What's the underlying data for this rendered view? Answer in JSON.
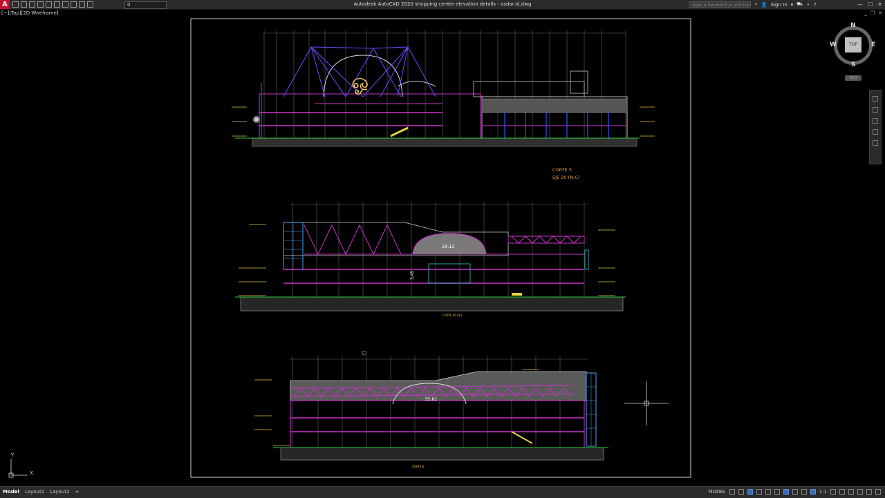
{
  "app": {
    "logo": "A",
    "title": "Autodesk AutoCAD 2020   shopping center elevation details - asdar.id.dwg"
  },
  "toolbar": {
    "layer_value": "0"
  },
  "search": {
    "placeholder": "Type a keyword or phrase"
  },
  "account": {
    "sign_in": "Sign In"
  },
  "viewport": {
    "label": "[−][Top][2D Wireframe]"
  },
  "viewcube": {
    "north": "N",
    "south": "S",
    "east": "E",
    "west": "W",
    "face": "TOP",
    "wcs": "WCS"
  },
  "drawing": {
    "section_title": "CORTE 5",
    "section_subtitle": "EJE 20 (N-C)",
    "dim_middle": "29,12",
    "dim_middle_vertical": "3,45",
    "caption_middle": "CORTE 06 (m)",
    "dim_bottom": "35,61",
    "caption_bottom": "CORTE 8"
  },
  "statusbar": {
    "tabs": [
      "Model",
      "Layout1",
      "Layout2"
    ],
    "add_tab": "+",
    "model_space": "MODEL",
    "scale": "1:1"
  },
  "colors": {
    "background": "#000000",
    "chrome": "#2b2b2b",
    "accent_magenta": "#cc33cc",
    "accent_yellow": "#e8c040",
    "accent_cyan": "#33cccc"
  }
}
